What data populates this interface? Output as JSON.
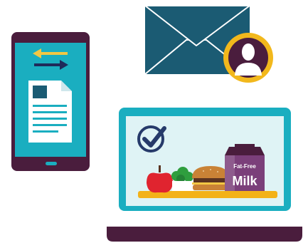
{
  "milk_carton": {
    "label_small": "Fat-Free",
    "label_big": "Milk"
  },
  "colors": {
    "background": "#ffffff",
    "plum": "#4a1d3d",
    "teal": "#1aaec0",
    "dark_teal": "#1b5b73",
    "screen_light": "#dff3f5",
    "arrow_yellow": "#f2c744",
    "navy": "#1f2a5a",
    "avatar_ring": "#f2b81c",
    "avatar_head": "#ffffff",
    "tray": "#f3b218",
    "apple_red": "#e0242f",
    "broccoli_green": "#2f9e3e",
    "bun": "#c98236",
    "patty": "#5a3320",
    "milk_purple": "#7b3f7a",
    "checkmark_navy": "#263a6a"
  },
  "icons": {
    "phone": "smartphone-icon",
    "document": "document-icon",
    "arrows": "swap-arrows-icon",
    "envelope": "envelope-icon",
    "avatar": "user-avatar-icon",
    "laptop": "laptop-icon",
    "checkmark": "checkmark-circle-icon",
    "meal": "meal-tray-icon"
  }
}
